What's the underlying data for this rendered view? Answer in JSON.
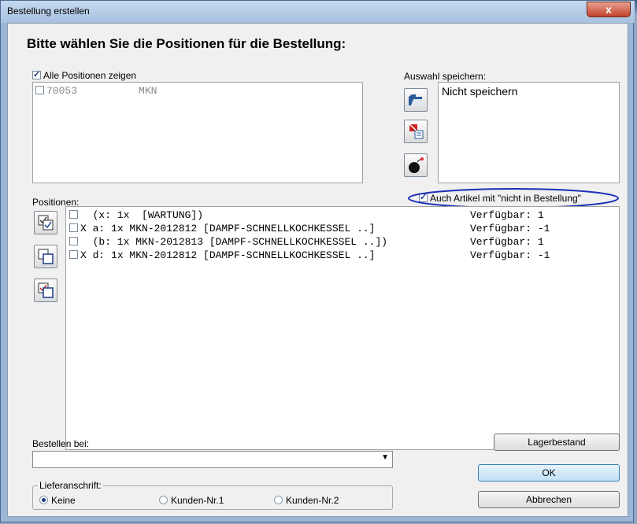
{
  "window": {
    "title": "Bestellung erstellen",
    "close_label": "x"
  },
  "heading": "Bitte wählen Sie die Positionen für die Bestellung:",
  "alle_positionen": {
    "label": "Alle Positionen zeigen",
    "checked": true
  },
  "top_list": [
    {
      "id": "70053",
      "name": "MKN",
      "checked": false
    }
  ],
  "auswahl": {
    "label": "Auswahl speichern:",
    "value": "Nicht speichern"
  },
  "auch_artikel": {
    "label": "Auch Artikel mit \"nicht in Bestellung\"",
    "checked": true
  },
  "positionen_label": "Positionen:",
  "positions": [
    {
      "prefix": "  ",
      "text": "(x: 1x  [WARTUNG])",
      "avail": "Verfügbar: 1"
    },
    {
      "prefix": "X ",
      "text": "a: 1x MKN-2012812 [DAMPF-SCHNELLKOCHKESSEL ..]",
      "avail": "Verfügbar: -1"
    },
    {
      "prefix": "  ",
      "text": "(b: 1x MKN-2012813 [DAMPF-SCHNELLKOCHKESSEL ..])",
      "avail": "Verfügbar: 1"
    },
    {
      "prefix": "X ",
      "text": "d: 1x MKN-2012812 [DAMPF-SCHNELLKOCHKESSEL ..]",
      "avail": "Verfügbar: -1"
    }
  ],
  "bestellen_bei": {
    "label": "Bestellen bei:",
    "value": ""
  },
  "lieferanschrift": {
    "label": "Lieferanschrift:",
    "options": [
      "Keine",
      "Kunden-Nr.1",
      "Kunden-Nr.2"
    ],
    "selected": "Keine"
  },
  "buttons": {
    "lagerbestand": "Lagerbestand",
    "ok": "OK",
    "abbrechen": "Abbrechen"
  },
  "colors": {
    "highlight_ellipse": "#1a2fb8",
    "title_bg": "#b6cbe6",
    "close_red": "#c2412c"
  }
}
